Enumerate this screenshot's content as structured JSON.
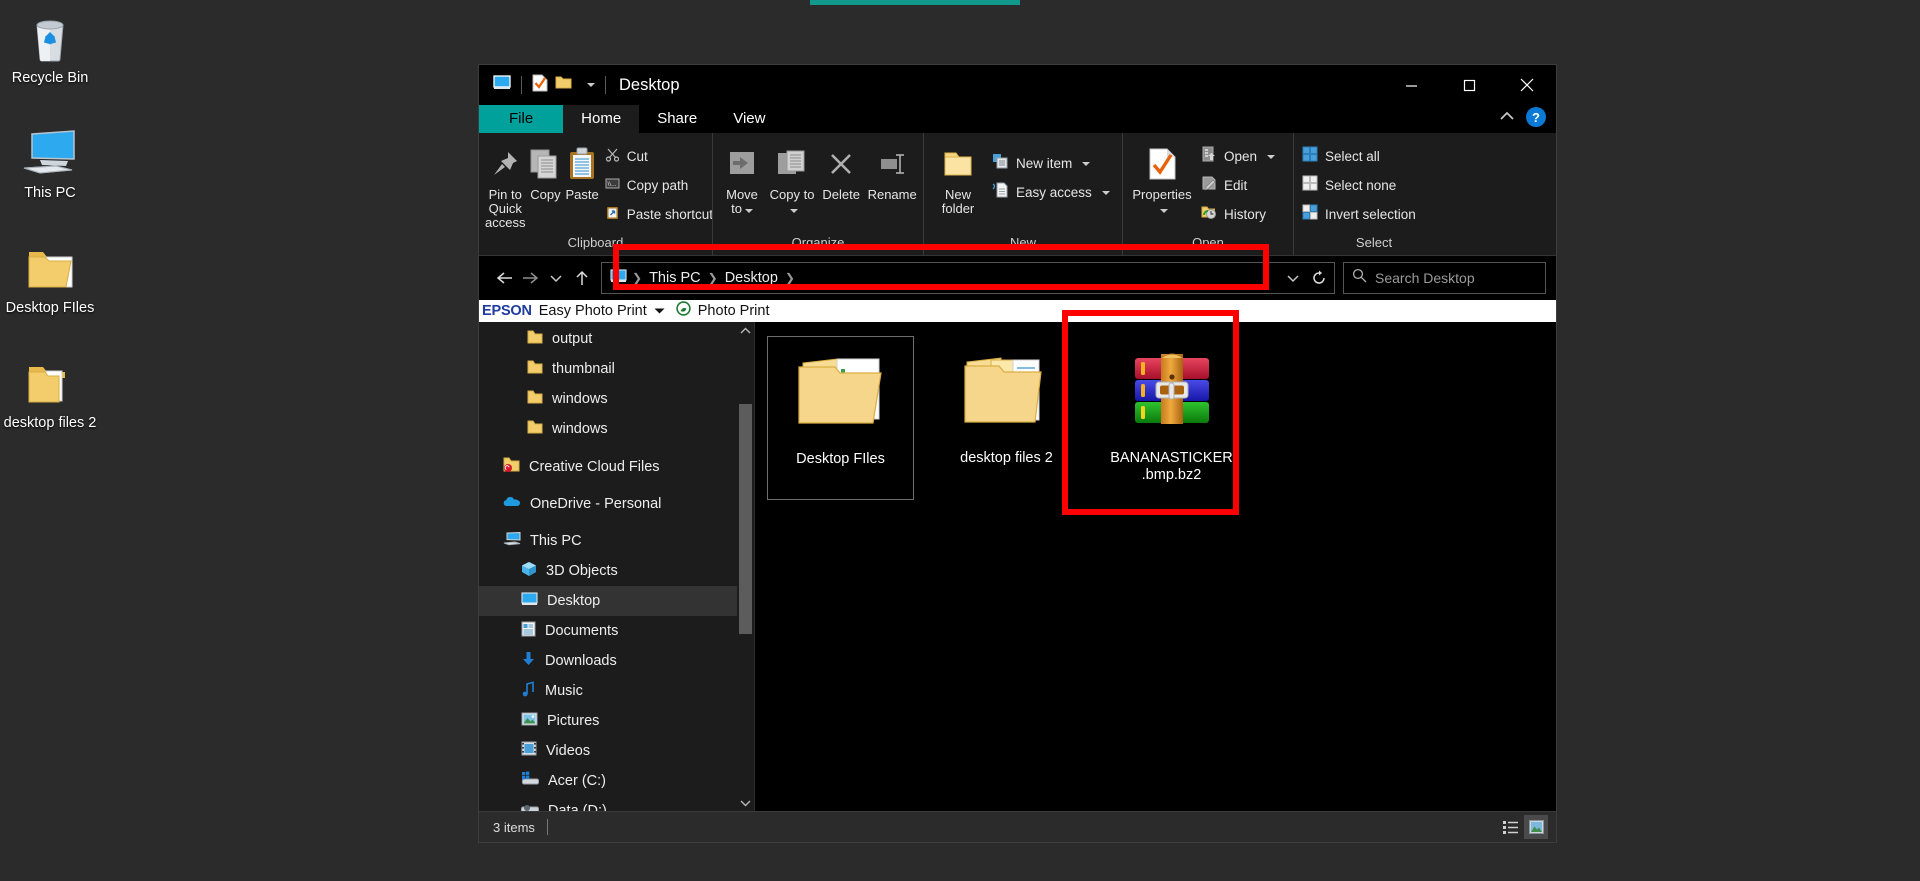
{
  "desktop": {
    "icons": [
      {
        "name": "Recycle Bin",
        "icon": "recycle-bin-icon"
      },
      {
        "name": "This PC",
        "icon": "this-pc-icon"
      },
      {
        "name": "Desktop FIles",
        "icon": "banana-folder-icon"
      },
      {
        "name": "desktop files 2",
        "icon": "documents-folder-icon"
      }
    ]
  },
  "window": {
    "title": "Desktop",
    "quick_access": [
      "desktop-icon",
      "properties-check-icon",
      "folder-icon",
      "chevron-down-icon"
    ],
    "controls": {
      "minimize": "–",
      "maximize": "☐",
      "close": "✕"
    },
    "tabs": [
      {
        "label": "File",
        "id": "tab-file"
      },
      {
        "label": "Home",
        "id": "tab-home"
      },
      {
        "label": "Share",
        "id": "tab-share"
      },
      {
        "label": "View",
        "id": "tab-view"
      }
    ],
    "active_tab": "Home",
    "ribbon_collapse_icon": "chevron-up-icon",
    "help_label": "?"
  },
  "ribbon": {
    "groups": [
      {
        "label": "Clipboard",
        "big": [
          {
            "label": "Pin to Quick access",
            "icon": "pin-icon"
          },
          {
            "label": "Copy",
            "icon": "copy-icon"
          },
          {
            "label": "Paste",
            "icon": "paste-icon"
          }
        ],
        "small": [
          {
            "label": "Cut",
            "icon": "scissors-icon"
          },
          {
            "label": "Copy path",
            "icon": "copy-path-icon"
          },
          {
            "label": "Paste shortcut",
            "icon": "paste-shortcut-icon"
          }
        ]
      },
      {
        "label": "Organize",
        "big": [
          {
            "label": "Move to",
            "icon": "move-to-icon",
            "dropdown": true
          },
          {
            "label": "Copy to",
            "icon": "copy-to-icon",
            "dropdown": true
          },
          {
            "label": "Delete",
            "icon": "delete-x-icon",
            "dropdown": true
          },
          {
            "label": "Rename",
            "icon": "rename-icon"
          }
        ],
        "small": []
      },
      {
        "label": "New",
        "big": [
          {
            "label": "New folder",
            "icon": "new-folder-icon"
          }
        ],
        "small": [
          {
            "label": "New item",
            "icon": "new-item-icon",
            "dropdown": true
          },
          {
            "label": "Easy access",
            "icon": "easy-access-icon",
            "dropdown": true
          }
        ]
      },
      {
        "label": "Open",
        "big": [
          {
            "label": "Properties",
            "icon": "properties-icon",
            "dropdown": true
          }
        ],
        "small": [
          {
            "label": "Open",
            "icon": "open-icon",
            "dropdown": true
          },
          {
            "label": "Edit",
            "icon": "edit-icon"
          },
          {
            "label": "History",
            "icon": "history-icon"
          }
        ]
      },
      {
        "label": "Select",
        "big": [],
        "small": [
          {
            "label": "Select all",
            "icon": "select-all-icon"
          },
          {
            "label": "Select none",
            "icon": "select-none-icon"
          },
          {
            "label": "Invert selection",
            "icon": "invert-selection-icon"
          }
        ]
      }
    ]
  },
  "addressbar": {
    "back_icon": "back-arrow-icon",
    "forward_icon": "forward-arrow-icon",
    "recent_icon": "chevron-down-icon",
    "up_icon": "up-arrow-icon",
    "path_icon": "desktop-icon",
    "crumbs": [
      "This PC",
      "Desktop"
    ],
    "dropdown_icon": "chevron-down-icon",
    "refresh_icon": "refresh-icon",
    "search_placeholder": "Search Desktop",
    "search_value": "",
    "search_icon": "search-icon"
  },
  "epson_bar": {
    "logo": "EPSON",
    "menu_label": "Easy Photo Print",
    "menu_caret_icon": "chevron-down-icon",
    "button_label": "Photo Print",
    "button_icon": "photo-print-icon"
  },
  "nav_pane": {
    "scroll_up_icon": "chevron-up-icon",
    "scroll_down_icon": "chevron-down-icon",
    "items": [
      {
        "label": "output",
        "icon": "folder-icon",
        "depth": 3,
        "selected": false
      },
      {
        "label": "thumbnail",
        "icon": "folder-icon",
        "depth": 3,
        "selected": false
      },
      {
        "label": "windows",
        "icon": "folder-icon",
        "depth": 3,
        "selected": false
      },
      {
        "label": "windows",
        "icon": "folder-icon",
        "depth": 3,
        "selected": false
      },
      {
        "label": "Creative Cloud Files",
        "icon": "creative-cloud-icon",
        "depth": 1,
        "selected": false
      },
      {
        "label": "OneDrive - Personal",
        "icon": "onedrive-icon",
        "depth": 1,
        "selected": false
      },
      {
        "label": "This PC",
        "icon": "this-pc-icon",
        "depth": 1,
        "selected": false
      },
      {
        "label": "3D Objects",
        "icon": "3d-objects-icon",
        "depth": 2,
        "selected": false
      },
      {
        "label": "Desktop",
        "icon": "desktop-icon",
        "depth": 2,
        "selected": true
      },
      {
        "label": "Documents",
        "icon": "documents-icon",
        "depth": 2,
        "selected": false
      },
      {
        "label": "Downloads",
        "icon": "downloads-icon",
        "depth": 2,
        "selected": false
      },
      {
        "label": "Music",
        "icon": "music-icon",
        "depth": 2,
        "selected": false
      },
      {
        "label": "Pictures",
        "icon": "pictures-icon",
        "depth": 2,
        "selected": false
      },
      {
        "label": "Videos",
        "icon": "videos-icon",
        "depth": 2,
        "selected": false
      },
      {
        "label": "Acer (C:)",
        "icon": "hard-drive-icon",
        "depth": 2,
        "selected": false
      },
      {
        "label": "Data (D:)",
        "icon": "hard-drive-icon",
        "depth": 2,
        "selected": false
      }
    ]
  },
  "file_list": {
    "items": [
      {
        "name": "Desktop FIles",
        "icon": "banana-folder-icon",
        "focused": true,
        "highlighted": false
      },
      {
        "name": "desktop files 2",
        "icon": "documents-folder-icon",
        "focused": false,
        "highlighted": false
      },
      {
        "name": "BANANASTICKER.bmp.bz2",
        "name_line1": "BANANASTICKER",
        "name_line2": ".bmp.bz2",
        "icon": "winrar-archive-icon",
        "focused": false,
        "highlighted": true
      }
    ]
  },
  "status_bar": {
    "item_count": "3 items",
    "details_view_icon": "details-view-icon",
    "large_icons_view_icon": "large-icons-view-icon"
  },
  "annotations": {
    "highlight_color": "#ff0000",
    "boxes": [
      {
        "name": "address-bar-highlight",
        "target": "addressbar"
      },
      {
        "name": "file-highlight",
        "target": "BANANASTICKER.bmp.bz2"
      }
    ]
  }
}
